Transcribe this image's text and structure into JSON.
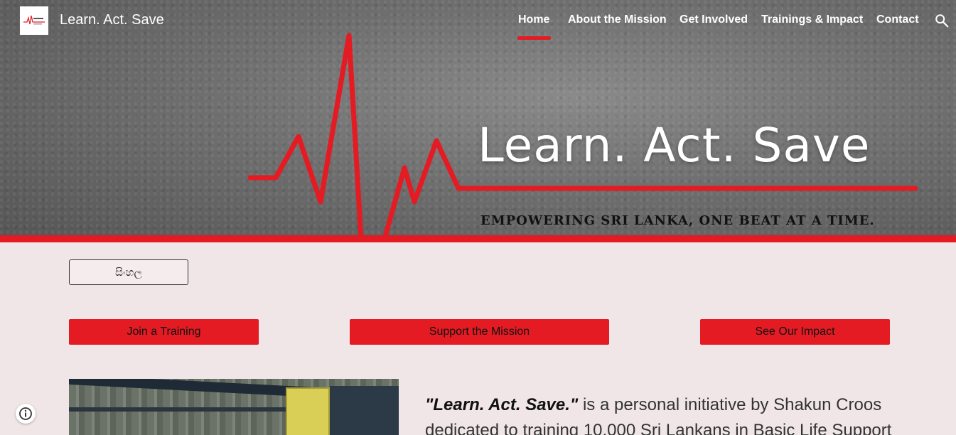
{
  "site": {
    "title": "Learn. Act. Save"
  },
  "nav": {
    "items": [
      {
        "label": "Home",
        "active": true
      },
      {
        "label": "About the Mission"
      },
      {
        "label": "Get Involved"
      },
      {
        "label": "Trainings & Impact"
      },
      {
        "label": "Contact"
      }
    ],
    "search_icon": "search-icon"
  },
  "hero": {
    "title": "Learn. Act. Save",
    "tagline": "EMPOWERING SRI LANKA, ONE BEAT AT A TIME."
  },
  "language_button": {
    "label": "සිංහල"
  },
  "cta": {
    "join": "Join a Training",
    "support": "Support the Mission",
    "impact": "See Our Impact"
  },
  "intro": {
    "lead": "\"Learn. Act. Save.\"",
    "text": " is a personal initiative by Shakun Croos",
    "line2": "dedicated to training 10,000 Sri Lankans in Basic Life Support"
  },
  "colors": {
    "accent": "#e41b23",
    "background": "#f0e6e7"
  }
}
